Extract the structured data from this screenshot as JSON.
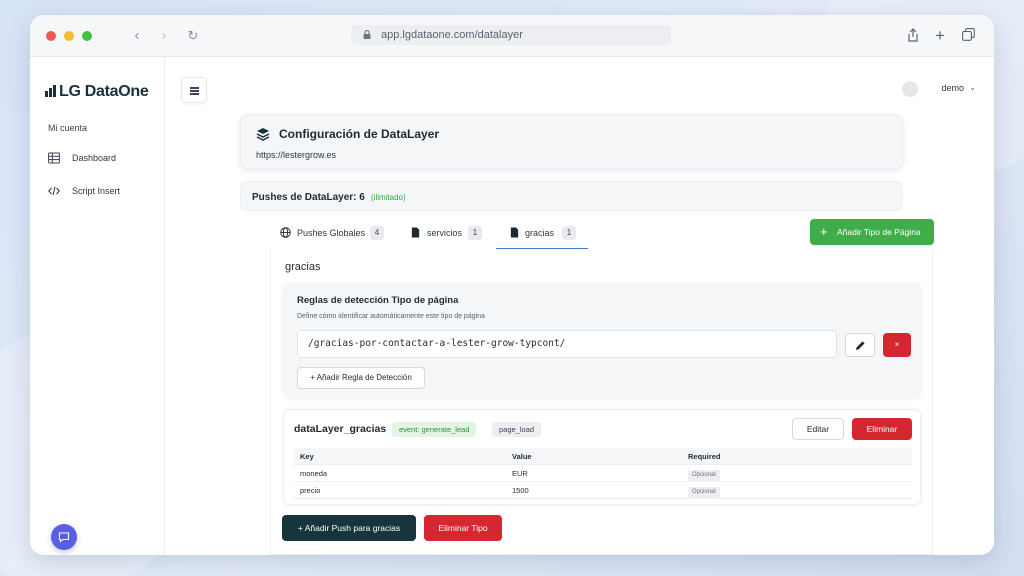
{
  "browser": {
    "url": "app.lgdataone.com/datalayer"
  },
  "sidebar": {
    "logo": "LG DataOne",
    "section": "Mi cuenta",
    "items": [
      {
        "label": "Dashboard",
        "icon": "table-icon"
      },
      {
        "label": "Script Insert",
        "icon": "code-icon"
      }
    ]
  },
  "header": {
    "user": "demo"
  },
  "config": {
    "title": "Configuración de DataLayer",
    "site": "https://lestergrow.es"
  },
  "pushes": {
    "label": "Pushes de DataLayer: 6",
    "limit": "(ilimitado)"
  },
  "tabs": [
    {
      "label": "Pushes Globales",
      "count": "4",
      "icon": "globe-icon"
    },
    {
      "label": "servicios",
      "count": "1",
      "icon": "file-icon"
    },
    {
      "label": "gracias",
      "count": "1",
      "icon": "file-icon",
      "active": true
    }
  ],
  "add_type_button": "Añadir Tipo de Página",
  "page_type": {
    "title": "gracias",
    "rules_heading": "Reglas de detección Tipo de página",
    "rules_description": "Define cómo identificar automáticamente este tipo de página",
    "rule_value": "/gracias-por-contactar-a-lester-grow-typcont/",
    "delete_rule_glyph": "×",
    "add_rule_button": "+ Añadir Regla de Detección"
  },
  "datalayer": {
    "name": "dataLayer_gracias",
    "event_tag": "event:  generate_lead",
    "trigger_tag": "page_load",
    "edit_button": "Editar",
    "delete_button": "Eliminar",
    "columns": [
      "Key",
      "Value",
      "Required"
    ],
    "rows": [
      {
        "key": "moneda",
        "value": "EUR",
        "required": "Opcional"
      },
      {
        "key": "precio",
        "value": "1500",
        "required": "Opcional"
      }
    ]
  },
  "actions": {
    "add_push": "+ Añadir Push para gracias",
    "delete_type": "Eliminar Tipo"
  },
  "colors": {
    "green": "#3fae4a",
    "red": "#d5272f",
    "dark_teal": "#17353d",
    "tab_underline": "#3b82c4",
    "chat": "#5a5fe0"
  }
}
